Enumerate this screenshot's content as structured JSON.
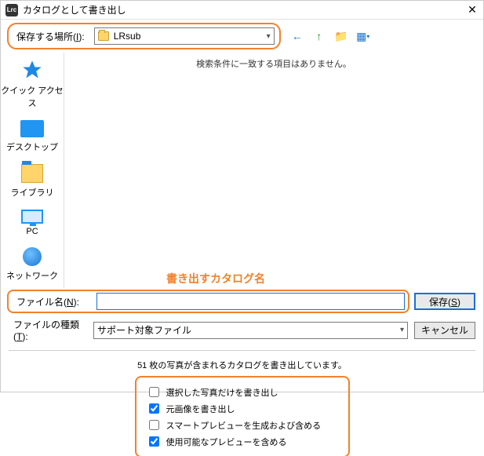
{
  "window": {
    "app_badge": "Lrc",
    "title": "カタログとして書き出し"
  },
  "location": {
    "label_pre": "保存する場所(",
    "label_key": "I",
    "label_post": "):",
    "value": "LRsub"
  },
  "toolbar_icons": {
    "back": "←",
    "up": "↑",
    "new": "📁",
    "view": "▦"
  },
  "sidebar": {
    "quick": "クイック アクセス",
    "desktop": "デスクトップ",
    "library": "ライブラリ",
    "pc": "PC",
    "network": "ネットワーク"
  },
  "browse": {
    "empty": "検索条件に一致する項目はありません。"
  },
  "annotation": "書き出すカタログ名",
  "filename": {
    "label_pre": "ファイル名(",
    "label_key": "N",
    "label_post": "):",
    "value": ""
  },
  "filetype": {
    "label_pre": "ファイルの種類(",
    "label_key": "T",
    "label_post": "):",
    "value": "サポート対象ファイル"
  },
  "buttons": {
    "save_pre": "保存(",
    "save_key": "S",
    "save_post": ")",
    "cancel": "キャンセル"
  },
  "info": "51 枚の写真が含まれるカタログを書き出しています。",
  "options": {
    "opt1": {
      "label": "選択した写真だけを書き出し",
      "checked": false
    },
    "opt2": {
      "label": "元画像を書き出し",
      "checked": true
    },
    "opt3": {
      "label": "スマートプレビューを生成および含める",
      "checked": false
    },
    "opt4": {
      "label": "使用可能なプレビューを含める",
      "checked": true
    }
  }
}
